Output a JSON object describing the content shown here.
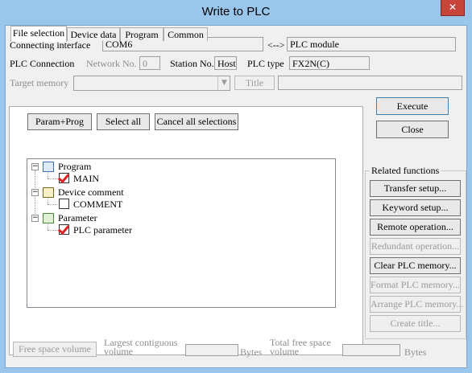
{
  "window": {
    "title": "Write to PLC",
    "close_glyph": "✕"
  },
  "connecting_interface": {
    "label": "Connecting interface",
    "value": "COM6",
    "arrow": "<-->",
    "target": "PLC module"
  },
  "plc_connection": {
    "label": "PLC Connection",
    "network_label": "Network No.",
    "network_value": "0",
    "station_label": "Station No.",
    "station_value": "Host",
    "type_label": "PLC type",
    "type_value": "FX2N(C)"
  },
  "target_memory": {
    "label": "Target memory",
    "value": "",
    "title_button": "Title",
    "title_value": ""
  },
  "tabs": [
    {
      "label": "File selection",
      "active": true
    },
    {
      "label": "Device data",
      "active": false
    },
    {
      "label": "Program",
      "active": false
    },
    {
      "label": "Common",
      "active": false
    }
  ],
  "selection_buttons": {
    "param_prog": "Param+Prog",
    "select_all": "Select all",
    "cancel_all": "Cancel all selections"
  },
  "tree": {
    "program": {
      "label": "Program",
      "child": "MAIN",
      "child_checked": true
    },
    "device_comment": {
      "label": "Device comment",
      "child": "COMMENT",
      "child_checked": false
    },
    "parameter": {
      "label": "Parameter",
      "child": "PLC parameter",
      "child_checked": true
    }
  },
  "actions": {
    "execute": "Execute",
    "close": "Close"
  },
  "related": {
    "title": "Related functions",
    "buttons": [
      {
        "label": "Transfer setup...",
        "enabled": true
      },
      {
        "label": "Keyword setup...",
        "enabled": true
      },
      {
        "label": "Remote operation...",
        "enabled": true
      },
      {
        "label": "Redundant operation...",
        "enabled": false
      },
      {
        "label": "Clear PLC memory...",
        "enabled": true
      },
      {
        "label": "Format PLC memory...",
        "enabled": false
      },
      {
        "label": "Arrange PLC memory...",
        "enabled": false
      },
      {
        "label": "Create title...",
        "enabled": false
      }
    ]
  },
  "free_space": {
    "button": "Free space volume",
    "largest_label": "Largest contiguous volume",
    "largest_unit": "Bytes",
    "total_label": "Total free space volume",
    "total_unit": "Bytes"
  },
  "colors": {
    "titlebar": "#9bc6ec",
    "close_button": "#c7443b",
    "check": "#dd2222"
  }
}
